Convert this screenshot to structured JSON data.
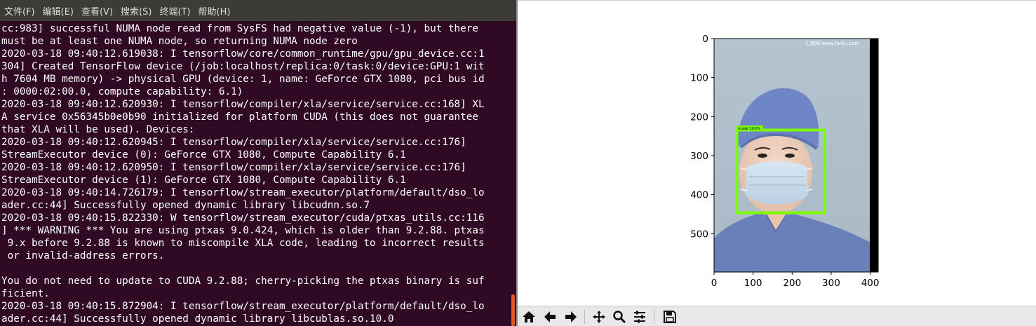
{
  "terminal": {
    "menu": [
      "文件(F)",
      "编辑(E)",
      "查看(V)",
      "搜索(S)",
      "终端(T)",
      "帮助(H)"
    ],
    "lines": [
      "cc:983] successful NUMA node read from SysFS had negative value (-1), but there",
      "must be at least one NUMA node, so returning NUMA node zero",
      "2020-03-18 09:40:12.619038: I tensorflow/core/common_runtime/gpu/gpu_device.cc:1",
      "304] Created TensorFlow device (/job:localhost/replica:0/task:0/device:GPU:1 wit",
      "h 7604 MB memory) -> physical GPU (device: 1, name: GeForce GTX 1080, pci bus id",
      ": 0000:02:00.0, compute capability: 6.1)",
      "2020-03-18 09:40:12.620930: I tensorflow/compiler/xla/service/service.cc:168] XL",
      "A service 0x56345b0e0b90 initialized for platform CUDA (this does not guarantee",
      "that XLA will be used). Devices:",
      "2020-03-18 09:40:12.620945: I tensorflow/compiler/xla/service/service.cc:176]",
      "StreamExecutor device (0): GeForce GTX 1080, Compute Capability 6.1",
      "2020-03-18 09:40:12.620950: I tensorflow/compiler/xla/service/service.cc:176]",
      "StreamExecutor device (1): GeForce GTX 1080, Compute Capability 6.1",
      "2020-03-18 09:40:14.726179: I tensorflow/stream_executor/platform/default/dso_lo",
      "ader.cc:44] Successfully opened dynamic library libcudnn.so.7",
      "2020-03-18 09:40:15.822330: W tensorflow/stream_executor/cuda/ptxas_utils.cc:116",
      "] *** WARNING *** You are using ptxas 9.0.424, which is older than 9.2.88. ptxas",
      " 9.x before 9.2.88 is known to miscompile XLA code, leading to incorrect results",
      " or invalid-address errors.",
      "",
      "You do not need to update to CUDA 9.2.88; cherry-picking the ptxas binary is suf",
      "ficient.",
      "2020-03-18 09:40:15.872904: I tensorflow/stream_executor/platform/default/dso_lo",
      "ader.cc:44] Successfully opened dynamic library libcublas.so.10.0"
    ],
    "colors": {
      "background": "#300a24",
      "menubar": "#3c3b37",
      "text": "#ffffff",
      "accent": "#e95420"
    }
  },
  "plot": {
    "x_ticks": [
      "0",
      "100",
      "200",
      "300",
      "400"
    ],
    "y_ticks": [
      "0",
      "100",
      "200",
      "300",
      "400",
      "500"
    ],
    "image_watermark": "汇图网 www.huitu.com",
    "detection_label": "mask  100%",
    "box_color": "#7cfc00",
    "scrub_color": "#6b7fb8"
  },
  "toolbar": {
    "buttons": [
      "home-icon",
      "back-icon",
      "forward-icon",
      "pan-icon",
      "zoom-icon",
      "configure-icon",
      "save-icon"
    ]
  }
}
